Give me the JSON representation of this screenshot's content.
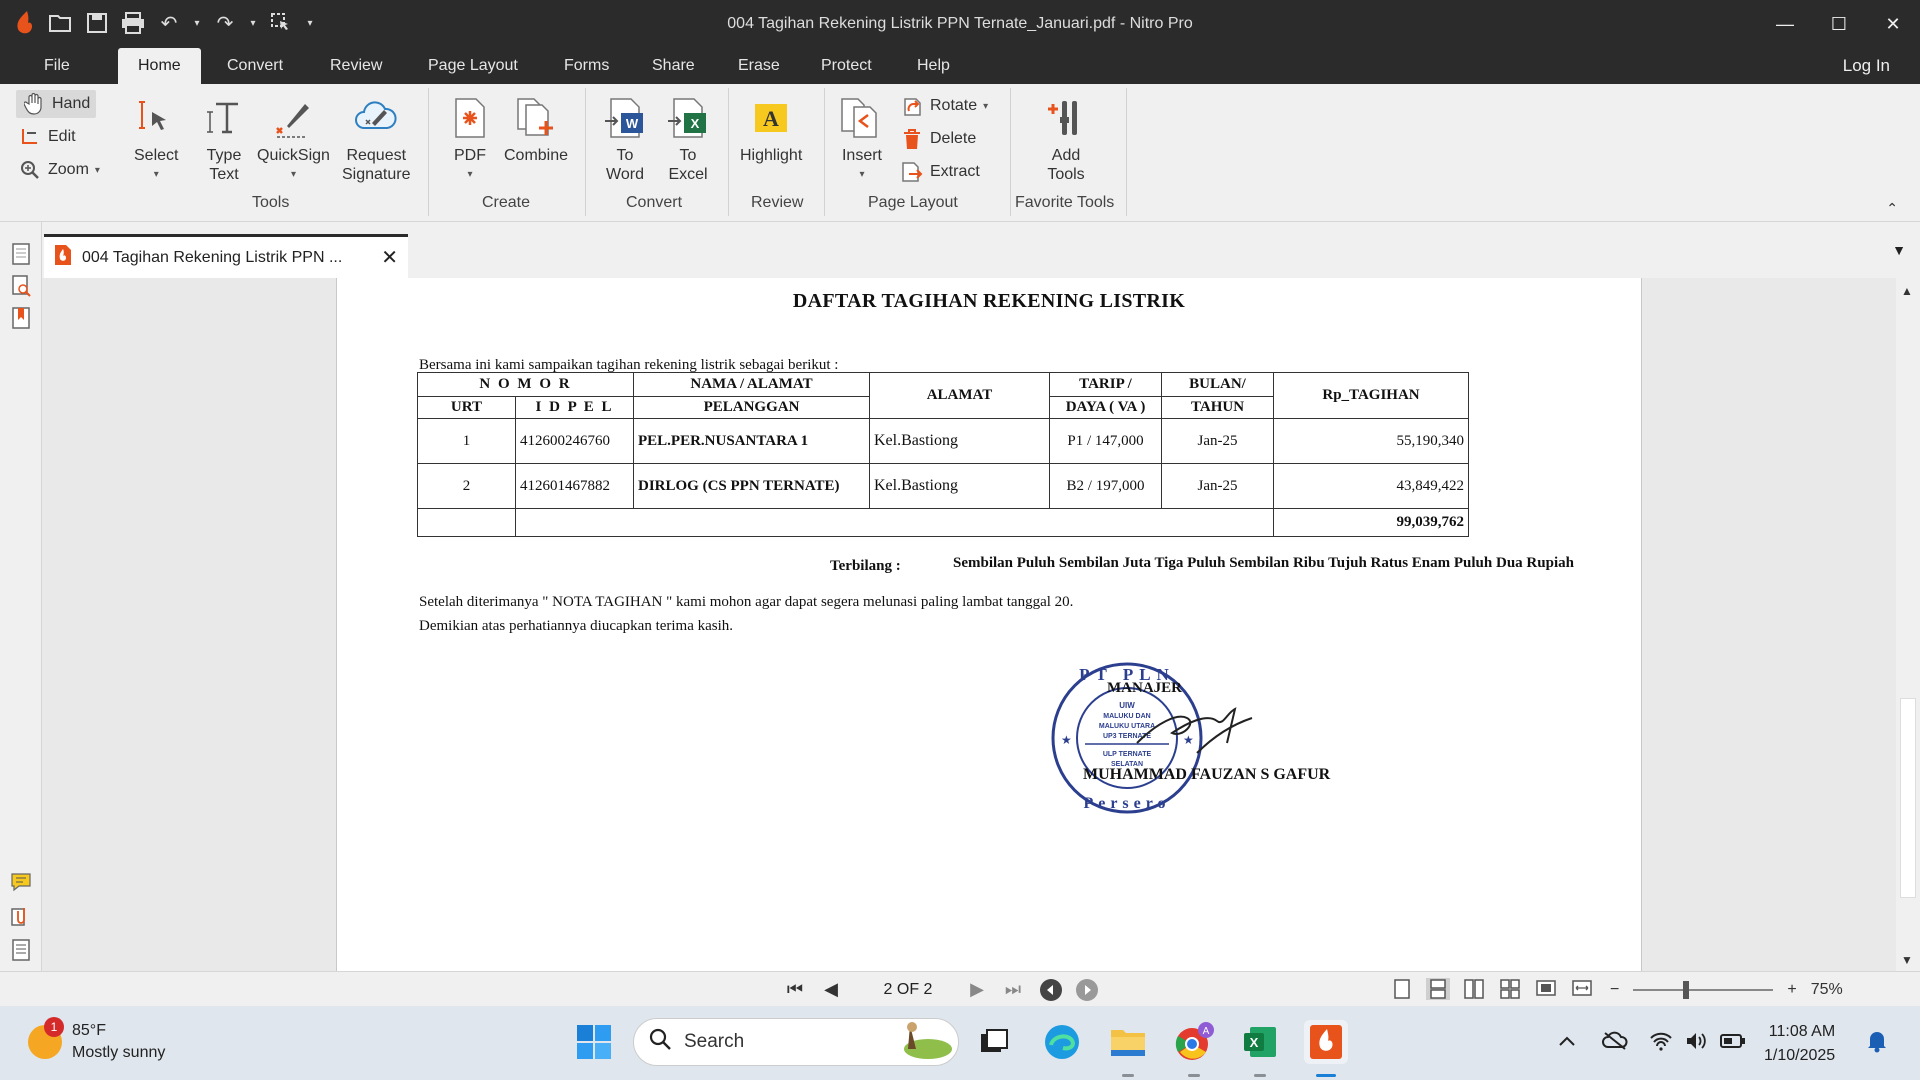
{
  "window": {
    "title": "004 Tagihan Rekening Listrik PPN Ternate_Januari.pdf - Nitro Pro",
    "log_in": "Log In"
  },
  "menu": [
    "File",
    "Home",
    "Convert",
    "Review",
    "Page Layout",
    "Forms",
    "Share",
    "Erase",
    "Protect",
    "Help"
  ],
  "ribbon": {
    "hand": "Hand",
    "edit": "Edit",
    "zoom": "Zoom",
    "select": "Select",
    "type_text_1": "Type",
    "type_text_2": "Text",
    "quicksign": "QuickSign",
    "request_sig_1": "Request",
    "request_sig_2": "Signature",
    "pdf": "PDF",
    "combine": "Combine",
    "to_word_1": "To",
    "to_word_2": "Word",
    "to_excel_1": "To",
    "to_excel_2": "Excel",
    "highlight": "Highlight",
    "insert": "Insert",
    "rotate": "Rotate",
    "delete": "Delete",
    "extract": "Extract",
    "add_tools_1": "Add",
    "add_tools_2": "Tools",
    "groups": {
      "tools": "Tools",
      "create": "Create",
      "convert": "Convert",
      "review": "Review",
      "page_layout": "Page Layout",
      "favorite_tools": "Favorite Tools"
    }
  },
  "doc_tab": {
    "label": "004 Tagihan Rekening Listrik PPN ..."
  },
  "document": {
    "title": "DAFTAR TAGIHAN REKENING LISTRIK",
    "intro": "Bersama ini kami sampaikan  tagihan rekening  listrik sebagai berikut :",
    "headers": {
      "nomor": "N O M O R",
      "urt": "URT",
      "idpel": "I D P E L",
      "nama_1": "NAMA / ALAMAT",
      "nama_2": "PELANGGAN",
      "alamat": "ALAMAT",
      "tarip_1": "TARIP /",
      "tarip_2": "DAYA ( VA )",
      "bulan_1": "BULAN/",
      "bulan_2": "TAHUN",
      "tagihan": "Rp_TAGIHAN"
    },
    "rows": [
      {
        "urt": "1",
        "idpel": "412600246760",
        "nama": "PEL.PER.NUSANTARA 1",
        "alamat": "Kel.Bastiong",
        "tarip": "P1 / 147,000",
        "bulan": "Jan-25",
        "tagihan": "55,190,340"
      },
      {
        "urt": "2",
        "idpel": "412601467882",
        "nama": "DIRLOG (CS PPN TERNATE)",
        "alamat": "Kel.Bastiong",
        "tarip": "B2 / 197,000",
        "bulan": "Jan-25",
        "tagihan": "43,849,422"
      }
    ],
    "total": "99,039,762",
    "terbilang_label": "Terbilang :",
    "terbilang_value": "Sembilan Puluh Sembilan Juta  Tiga Puluh Sembilan Ribu Tujuh Ratus Enam Puluh Dua Rupiah",
    "note_1": "Setelah diterimanya \" NOTA TAGIHAN \" kami mohon agar dapat segera melunasi paling lambat tanggal 20.",
    "note_2": "Demikian atas perhatiannya diucapkan terima kasih.",
    "manajer": "MANAJER",
    "signer": "MUHAMMAD FAUZAN S GAFUR",
    "stamp_text": "PT PLN (Persero) UIW MALUKU DAN MALUKU UTARA UP3 TERNATE ULP TERNATE SELATAN"
  },
  "statusbar": {
    "page": "2 OF 2",
    "zoom": "75%"
  },
  "taskbar": {
    "temp": "85°F",
    "weather": "Mostly sunny",
    "weather_badge": "1",
    "search": "Search",
    "time": "11:08 AM",
    "date": "1/10/2025"
  },
  "colors": {
    "accent": "#e8531b",
    "titlebar": "#2b2b2b",
    "ribbon": "#f0f0f0",
    "stamp": "#2c3f8f"
  }
}
